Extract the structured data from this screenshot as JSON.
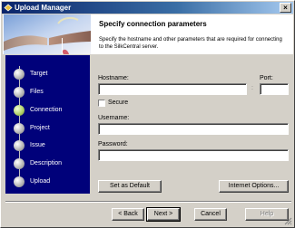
{
  "window": {
    "title": "Upload Manager",
    "close_label": "×"
  },
  "header": {
    "title": "Specify connection parameters",
    "description": "Specify the hostname and other parameters that are required for connecting to the SilkCentral server."
  },
  "sidebar": {
    "steps": [
      {
        "label": "Target",
        "active": false
      },
      {
        "label": "Files",
        "active": false
      },
      {
        "label": "Connection",
        "active": true
      },
      {
        "label": "Project",
        "active": false
      },
      {
        "label": "Issue",
        "active": false
      },
      {
        "label": "Description",
        "active": false
      },
      {
        "label": "Upload",
        "active": false
      }
    ]
  },
  "form": {
    "hostname_label": "Hostname:",
    "hostname_value": "",
    "port_label": "Port:",
    "port_value": "",
    "colon": ":",
    "secure_label": "Secure",
    "secure_checked": false,
    "username_label": "Username:",
    "username_value": "",
    "password_label": "Password:",
    "password_value": ""
  },
  "buttons": {
    "set_default": "Set as Default",
    "internet_options": "Internet Options...",
    "back": "< Back",
    "next": "Next >",
    "cancel": "Cancel",
    "help": "Help"
  }
}
